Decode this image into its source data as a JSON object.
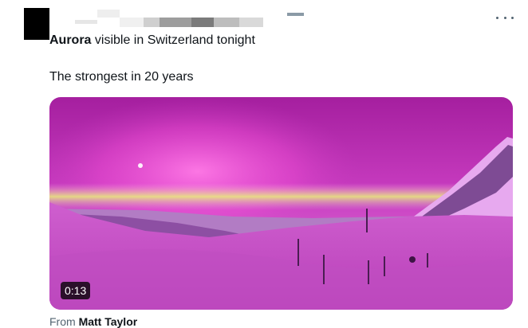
{
  "tweet": {
    "headline_bold": "Aurora",
    "headline_rest": " visible in Switzerland tonight",
    "body": "The strongest in 20 years",
    "more_icon": "more-horizontal-icon",
    "video": {
      "duration": "0:13",
      "thumbnail": "aurora-over-alpine-snow"
    },
    "source": {
      "prefix": "From ",
      "name": "Matt Taylor"
    }
  },
  "colors": {
    "text_primary": "#0f1419",
    "text_secondary": "#536471",
    "sky_top": "#b226a8",
    "aurora_glow": "#ff5ad8",
    "horizon_yellow": "#e9f27a",
    "snow": "#d46fd2"
  }
}
